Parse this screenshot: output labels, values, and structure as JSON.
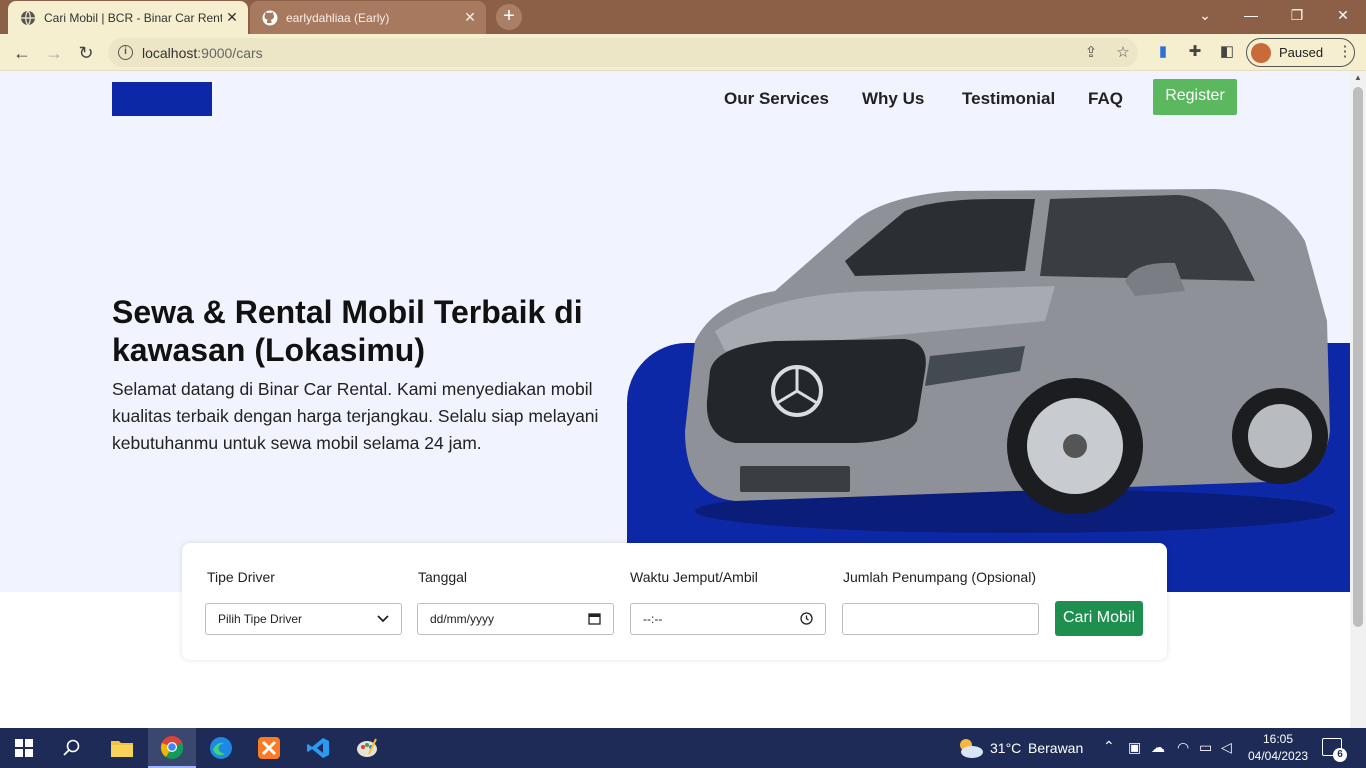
{
  "browser": {
    "tabs": [
      {
        "title": "Cari Mobil | BCR - Binar Car Rental",
        "icon": "globe-icon",
        "active": true
      },
      {
        "title": "earlydahliaa (Early)",
        "icon": "github-icon",
        "active": false
      }
    ],
    "new_tab_label": "+",
    "url_host": "localhost",
    "url_rest": ":9000/cars",
    "profile_status": "Paused",
    "window_controls": [
      "minimize",
      "restore",
      "close"
    ]
  },
  "page": {
    "nav": [
      "Our Services",
      "Why Us",
      "Testimonial",
      "FAQ"
    ],
    "register_label": "Register",
    "hero_title": "Sewa & Rental Mobil Terbaik di kawasan (Lokasimu)",
    "hero_text": "Selamat datang di Binar Car Rental. Kami menyediakan mobil kualitas terbaik dengan harga terjangkau. Selalu siap melayani kebutuhanmu untuk sewa mobil selama 24 jam.",
    "colors": {
      "brand_blue": "#0d28a6",
      "green_register": "#5cb85f",
      "green_search": "#1e8f4f",
      "hero_bg": "#f1f3ff"
    }
  },
  "search": {
    "labels": {
      "driver": "Tipe Driver",
      "date": "Tanggal",
      "time": "Waktu Jemput/Ambil",
      "passengers": "Jumlah Penumpang (Opsional)"
    },
    "driver_placeholder": "Pilih Tipe Driver",
    "date_placeholder": "dd/mm/yyyy",
    "time_placeholder": "--:--",
    "passengers_value": "",
    "button_label": "Cari Mobil"
  },
  "taskbar": {
    "weather_temp": "31°C",
    "weather_desc": "Berawan",
    "time": "16:05",
    "date": "04/04/2023",
    "notifications": "6"
  }
}
